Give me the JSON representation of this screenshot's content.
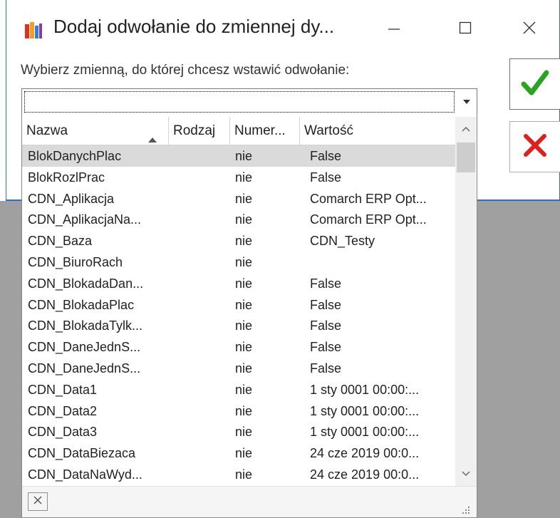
{
  "window": {
    "title": "Dodaj odwołanie do zmiennej dy...",
    "prompt": "Wybierz zmienną, do której chcesz wstawić odwołanie:",
    "combo_value": ""
  },
  "icons": {
    "app": "books-icon",
    "minimize": "minimize-icon",
    "maximize": "maximize-icon",
    "close": "close-icon",
    "ok": "green-checkmark-icon",
    "cancel": "red-x-icon",
    "dropdown": "chevron-down-icon",
    "sort": "sort-ascending-icon",
    "clear": "clear-x-icon",
    "resize": "resize-grip-icon"
  },
  "colors": {
    "ok_green": "#2aa31f",
    "cancel_red": "#e0201b",
    "selected_row": "#dadada",
    "window_border": "#2f6fbf",
    "background_gray": "#a0a0a0"
  },
  "table": {
    "columns": [
      "Nazwa",
      "Rodzaj",
      "Numer...",
      "Wartość"
    ],
    "rows": [
      {
        "name": "BlokDanychPlac",
        "kind": "",
        "num": "nie",
        "value": "False"
      },
      {
        "name": "BlokRozlPrac",
        "kind": "",
        "num": "nie",
        "value": "False"
      },
      {
        "name": "CDN_Aplikacja",
        "kind": "",
        "num": "nie",
        "value": "Comarch ERP Opt..."
      },
      {
        "name": "CDN_AplikacjaNa...",
        "kind": "",
        "num": "nie",
        "value": "Comarch ERP Opt..."
      },
      {
        "name": "CDN_Baza",
        "kind": "",
        "num": "nie",
        "value": "CDN_Testy"
      },
      {
        "name": "CDN_BiuroRach",
        "kind": "",
        "num": "nie",
        "value": ""
      },
      {
        "name": "CDN_BlokadaDan...",
        "kind": "",
        "num": "nie",
        "value": "False"
      },
      {
        "name": "CDN_BlokadaPlac",
        "kind": "",
        "num": "nie",
        "value": "False"
      },
      {
        "name": "CDN_BlokadaTylk...",
        "kind": "",
        "num": "nie",
        "value": "False"
      },
      {
        "name": "CDN_DaneJednS...",
        "kind": "",
        "num": "nie",
        "value": "False"
      },
      {
        "name": "CDN_DaneJednS...",
        "kind": "",
        "num": "nie",
        "value": "False"
      },
      {
        "name": "CDN_Data1",
        "kind": "",
        "num": "nie",
        "value": "1 sty 0001 00:00:..."
      },
      {
        "name": "CDN_Data2",
        "kind": "",
        "num": "nie",
        "value": "1 sty 0001 00:00:..."
      },
      {
        "name": "CDN_Data3",
        "kind": "",
        "num": "nie",
        "value": "1 sty 0001 00:00:..."
      },
      {
        "name": "CDN_DataBiezaca",
        "kind": "",
        "num": "nie",
        "value": "24 cze 2019 00:0..."
      },
      {
        "name": "CDN_DataNaWyd...",
        "kind": "",
        "num": "nie",
        "value": "24 cze 2019 00:0..."
      }
    ],
    "selected_index": 0
  }
}
